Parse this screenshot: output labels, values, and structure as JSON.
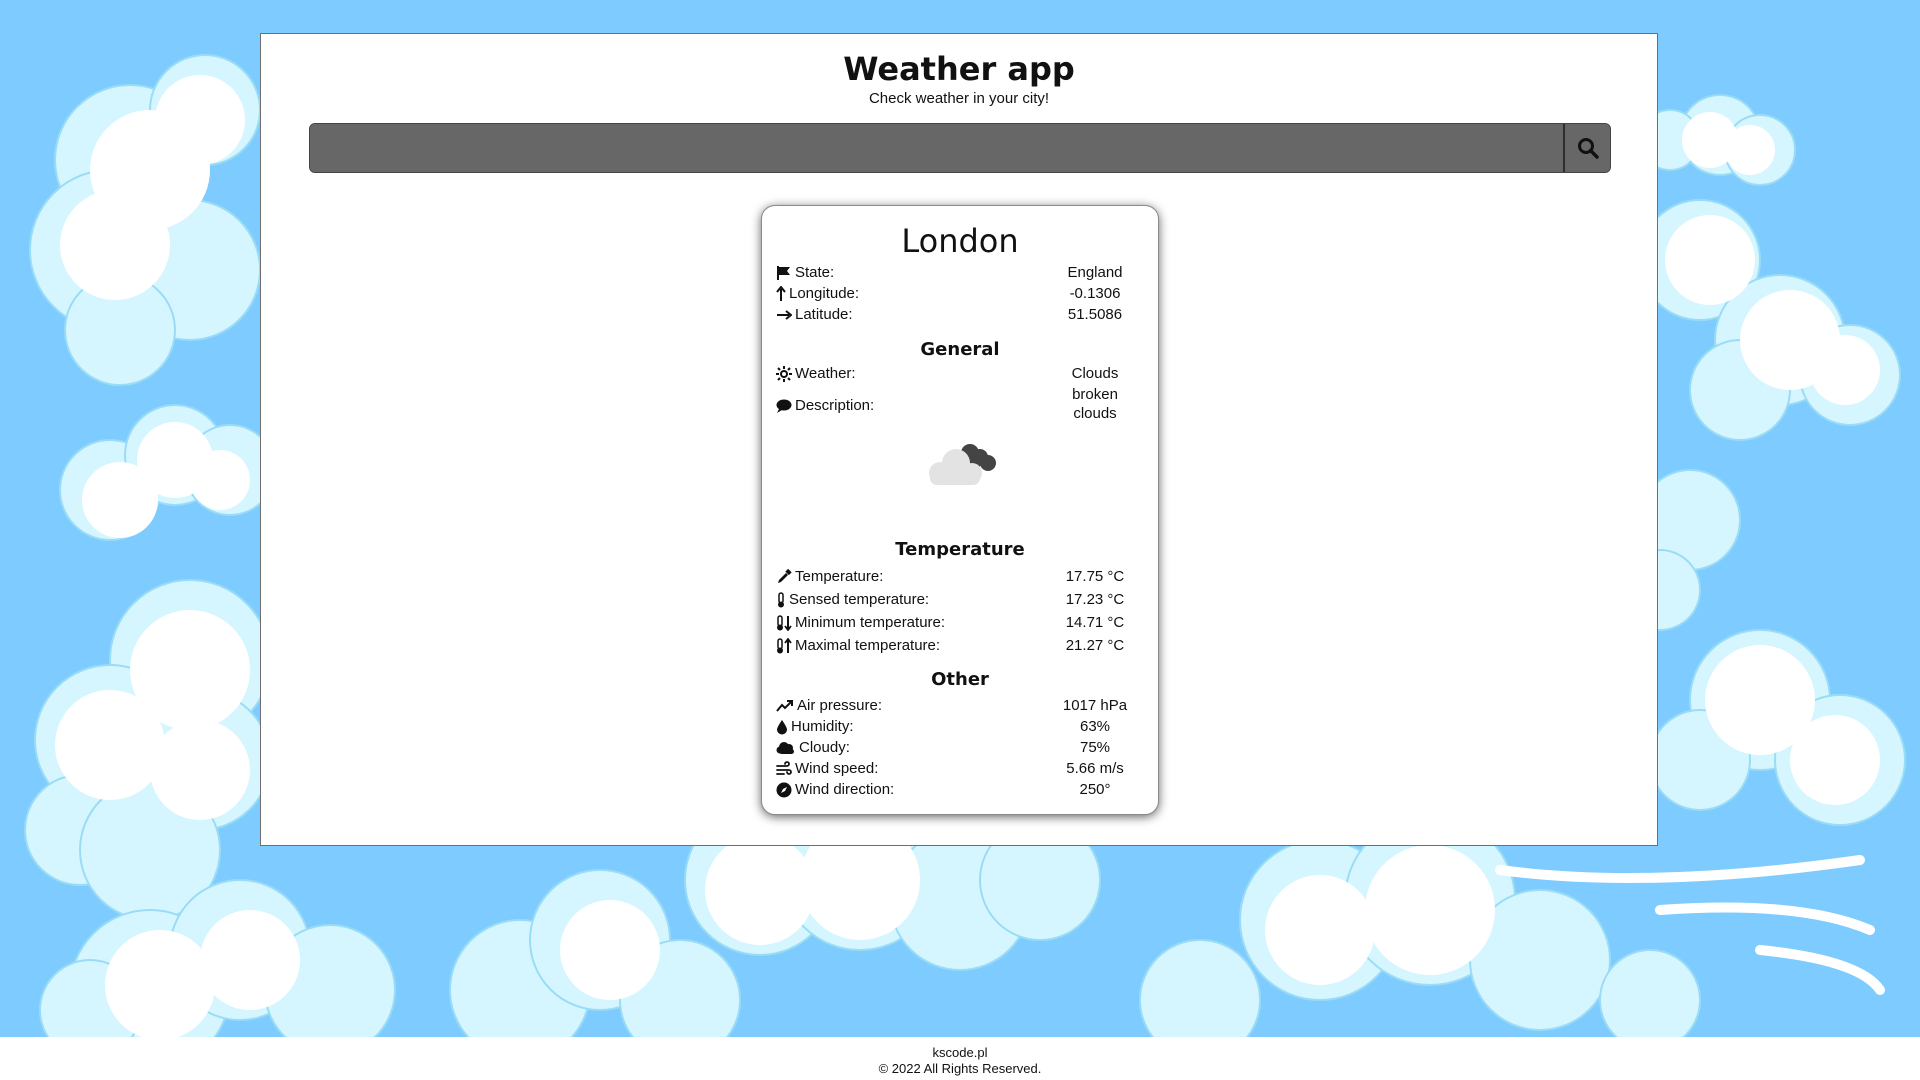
{
  "app": {
    "title": "Weather app",
    "subtitle": "Check weather in your city!"
  },
  "search": {
    "value": "",
    "placeholder": "",
    "button_icon": "search-icon"
  },
  "location": {
    "city": "London",
    "rows": [
      {
        "icon": "flag-icon",
        "label": "State:",
        "value": "England"
      },
      {
        "icon": "arrow-up-icon",
        "label": "Longitude:",
        "value": "-0.1306"
      },
      {
        "icon": "arrow-right-icon",
        "label": "Latitude:",
        "value": "51.5086"
      }
    ]
  },
  "general": {
    "heading": "General",
    "weather_label": "Weather:",
    "weather_value": "Clouds",
    "description_label": "Description:",
    "description_value": "broken clouds",
    "weather_icon": "broken-clouds-icon"
  },
  "temperature": {
    "heading": "Temperature",
    "rows": [
      {
        "icon": "eyedropper-icon",
        "label": "Temperature:",
        "value": "17.75 °C"
      },
      {
        "icon": "thermometer-icon",
        "label": "Sensed temperature:",
        "value": "17.23 °C"
      },
      {
        "icon": "thermometer-down-icon",
        "label": "Minimum temperature:",
        "value": "14.71 °C"
      },
      {
        "icon": "thermometer-up-icon",
        "label": "Maximal temperature:",
        "value": "21.27 °C"
      }
    ]
  },
  "other": {
    "heading": "Other",
    "rows": [
      {
        "icon": "trend-up-icon",
        "label": "Air pressure:",
        "value": "1017 hPa"
      },
      {
        "icon": "droplet-icon",
        "label": "Humidity:",
        "value": "63%"
      },
      {
        "icon": "cloud-icon",
        "label": "Cloudy:",
        "value": "75%"
      },
      {
        "icon": "wind-icon",
        "label": "Wind speed:",
        "value": "5.66 m/s"
      },
      {
        "icon": "compass-icon",
        "label": "Wind direction:",
        "value": "250°"
      }
    ]
  },
  "footer": {
    "site": "kscode.pl",
    "copyright": "© 2022 All Rights Reserved."
  },
  "colors": {
    "sky": "#7ecbff",
    "cloud": "#ffffff",
    "cloud_shade": "#d6f6ff",
    "search_bg": "#676767"
  }
}
